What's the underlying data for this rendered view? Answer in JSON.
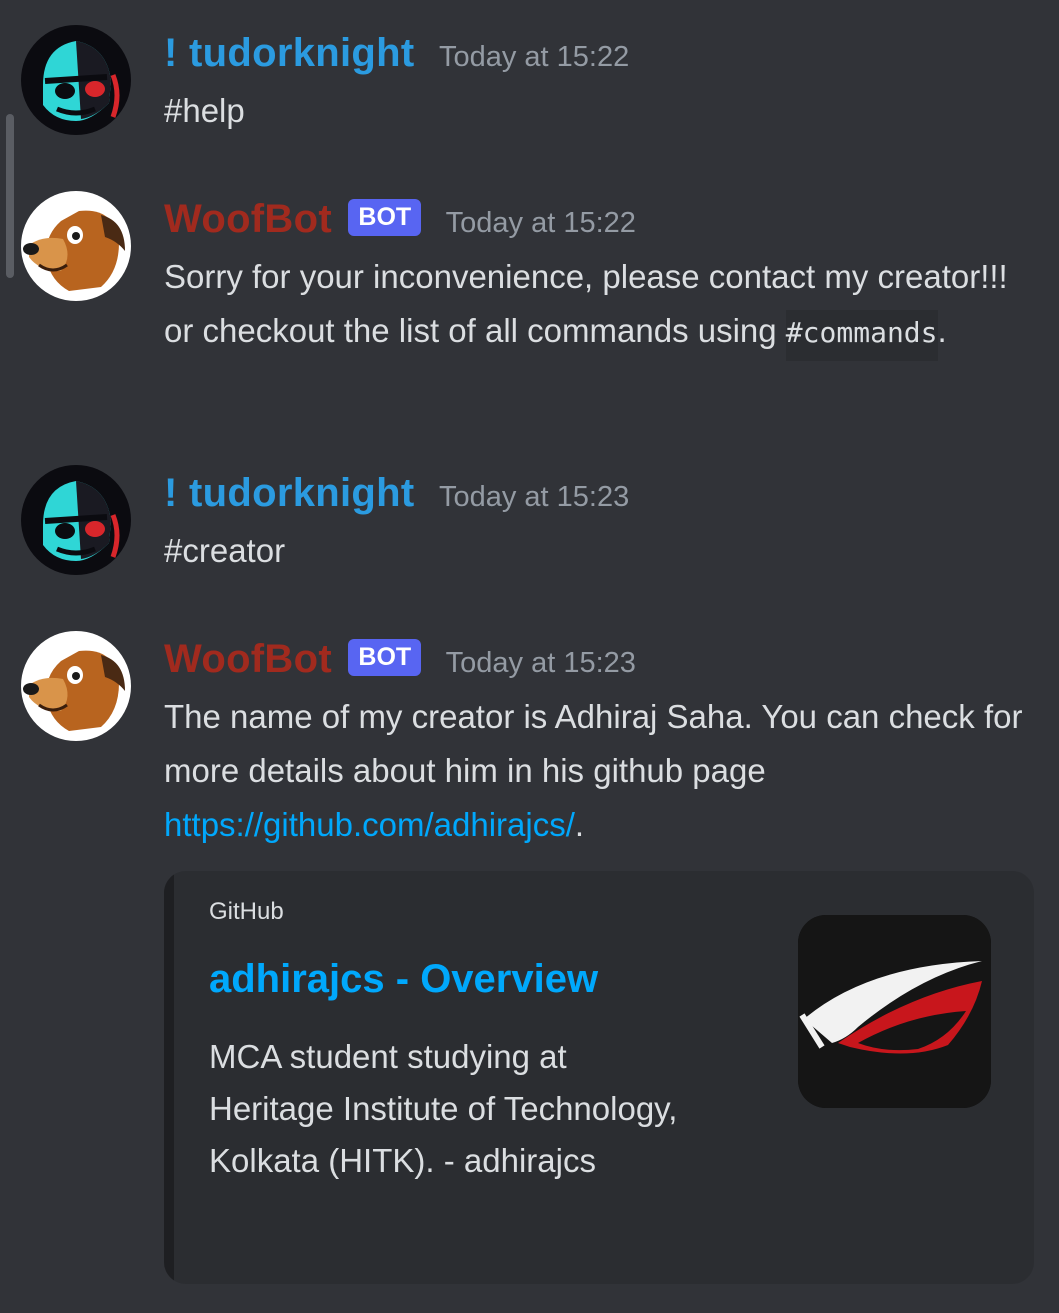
{
  "messages": [
    {
      "username": "! tudorknight",
      "timestamp": "Today at 15:22",
      "text": "#help"
    },
    {
      "username": "WoofBot",
      "badge": "BOT",
      "timestamp": "Today at 15:22",
      "text_before": "Sorry for your inconvenience, please contact my creator!!! or checkout the list of all commands using ",
      "code": "#commands",
      "text_after": "."
    },
    {
      "username": "! tudorknight",
      "timestamp": "Today at 15:23",
      "text": "#creator"
    },
    {
      "username": "WoofBot",
      "badge": "BOT",
      "timestamp": "Today at 15:23",
      "text_before": "The name of my creator is Adhiraj Saha. You can check for more details about him in his github page ",
      "link": "https://github.com/adhirajcs/",
      "text_after": "."
    }
  ],
  "embed": {
    "provider": "GitHub",
    "title": "adhirajcs - Overview",
    "description": "MCA student studying at Heritage Institute of Technology, Kolkata (HITK). - adhirajcs"
  },
  "colors": {
    "background": "#313338",
    "user_tudorknight": "#2b9be0",
    "user_woofbot": "#a12a1e",
    "bot_badge": "#5865f2",
    "link": "#00a8fc",
    "embed_background": "#2b2d31"
  },
  "icons": [
    "stormtrooper-avatar",
    "dog-avatar",
    "rog-logo-thumbnail"
  ]
}
